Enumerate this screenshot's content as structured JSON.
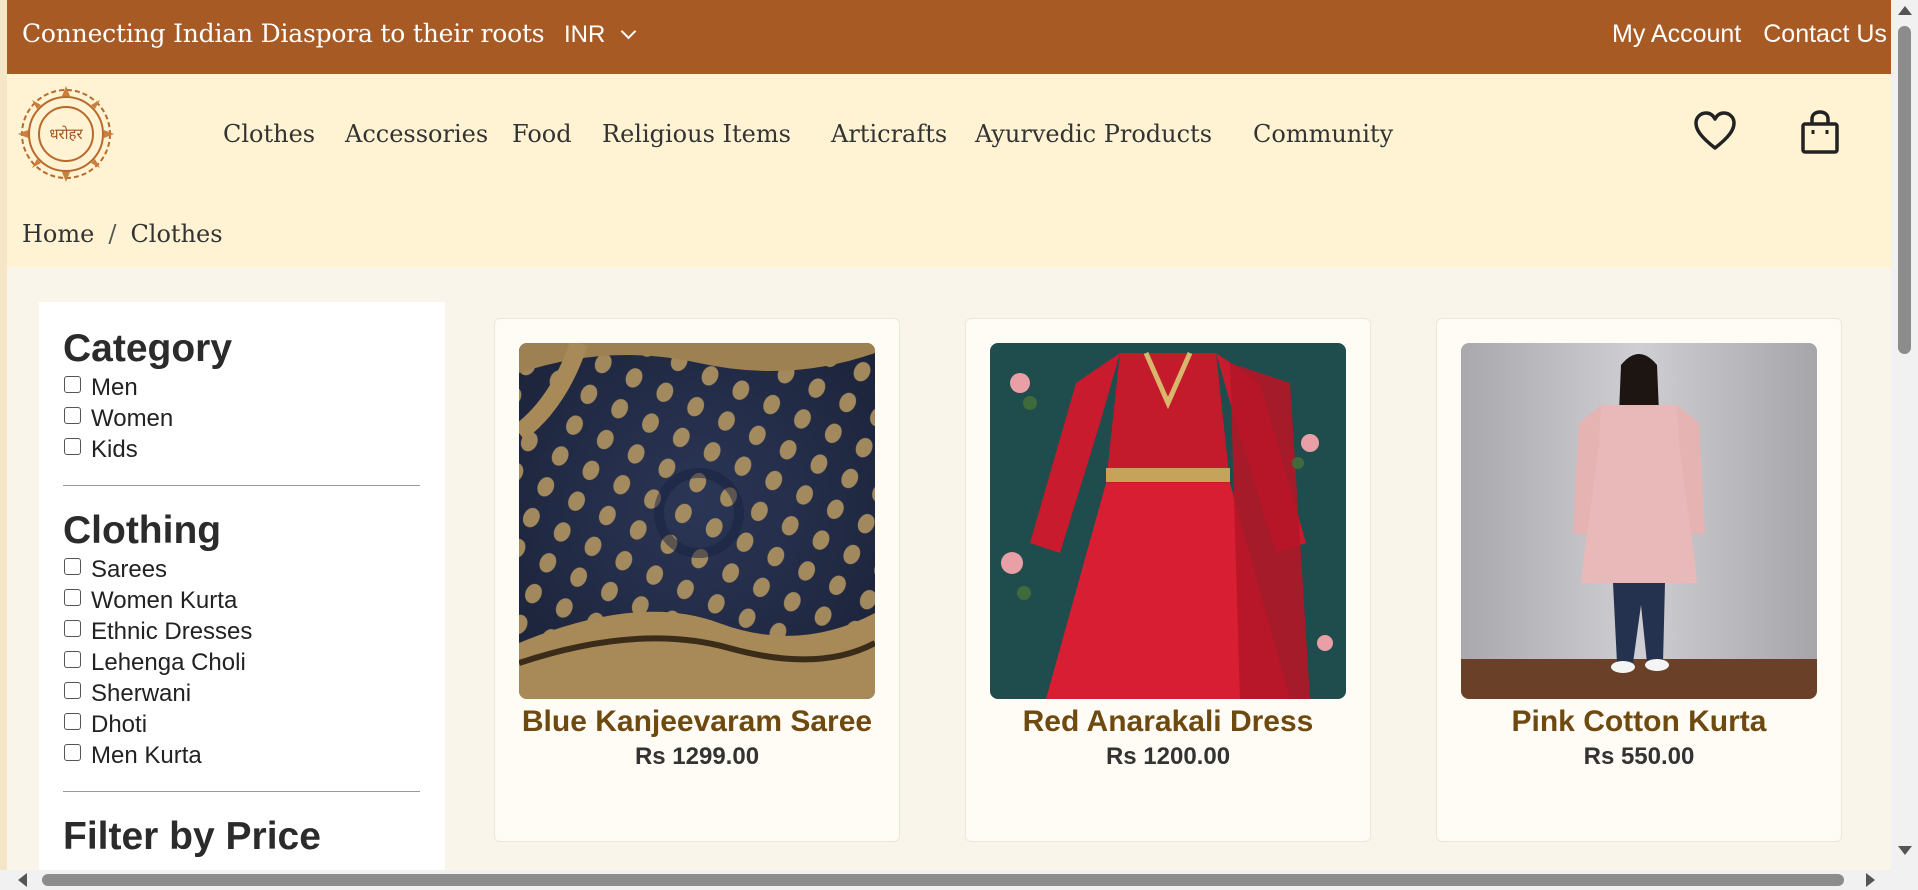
{
  "topbar": {
    "tagline": "Connecting Indian Diaspora to their roots",
    "currency": "INR",
    "links": [
      "My Account",
      "Contact Us"
    ]
  },
  "header": {
    "logo_text": "धरोहर",
    "nav": [
      "Clothes",
      "Accessories",
      "Food",
      "Religious Items",
      "Articrafts",
      "Ayurvedic Products",
      "Community"
    ],
    "icons": [
      "heart-icon",
      "shopping-bag-icon"
    ]
  },
  "breadcrumb": {
    "items": [
      "Home",
      "Clothes"
    ],
    "separator": "/"
  },
  "filters": {
    "category": {
      "title": "Category",
      "options": [
        "Men",
        "Women",
        "Kids"
      ]
    },
    "clothing": {
      "title": "Clothing",
      "options": [
        "Sarees",
        "Women Kurta",
        "Ethnic Dresses",
        "Lehenga Choli",
        "Sherwani",
        "Dhoti",
        "Men Kurta"
      ]
    },
    "price": {
      "title": "Filter by Price"
    }
  },
  "products": [
    {
      "name": "Blue Kanjeevaram Saree",
      "price": "Rs 1299.00"
    },
    {
      "name": "Red Anarakali Dress",
      "price": "Rs 1200.00"
    },
    {
      "name": "Pink Cotton Kurta",
      "price": "Rs 550.00"
    }
  ],
  "colors": {
    "topbar": "#a85a24",
    "header": "#fff3d3",
    "product_name": "#6e4a10"
  }
}
